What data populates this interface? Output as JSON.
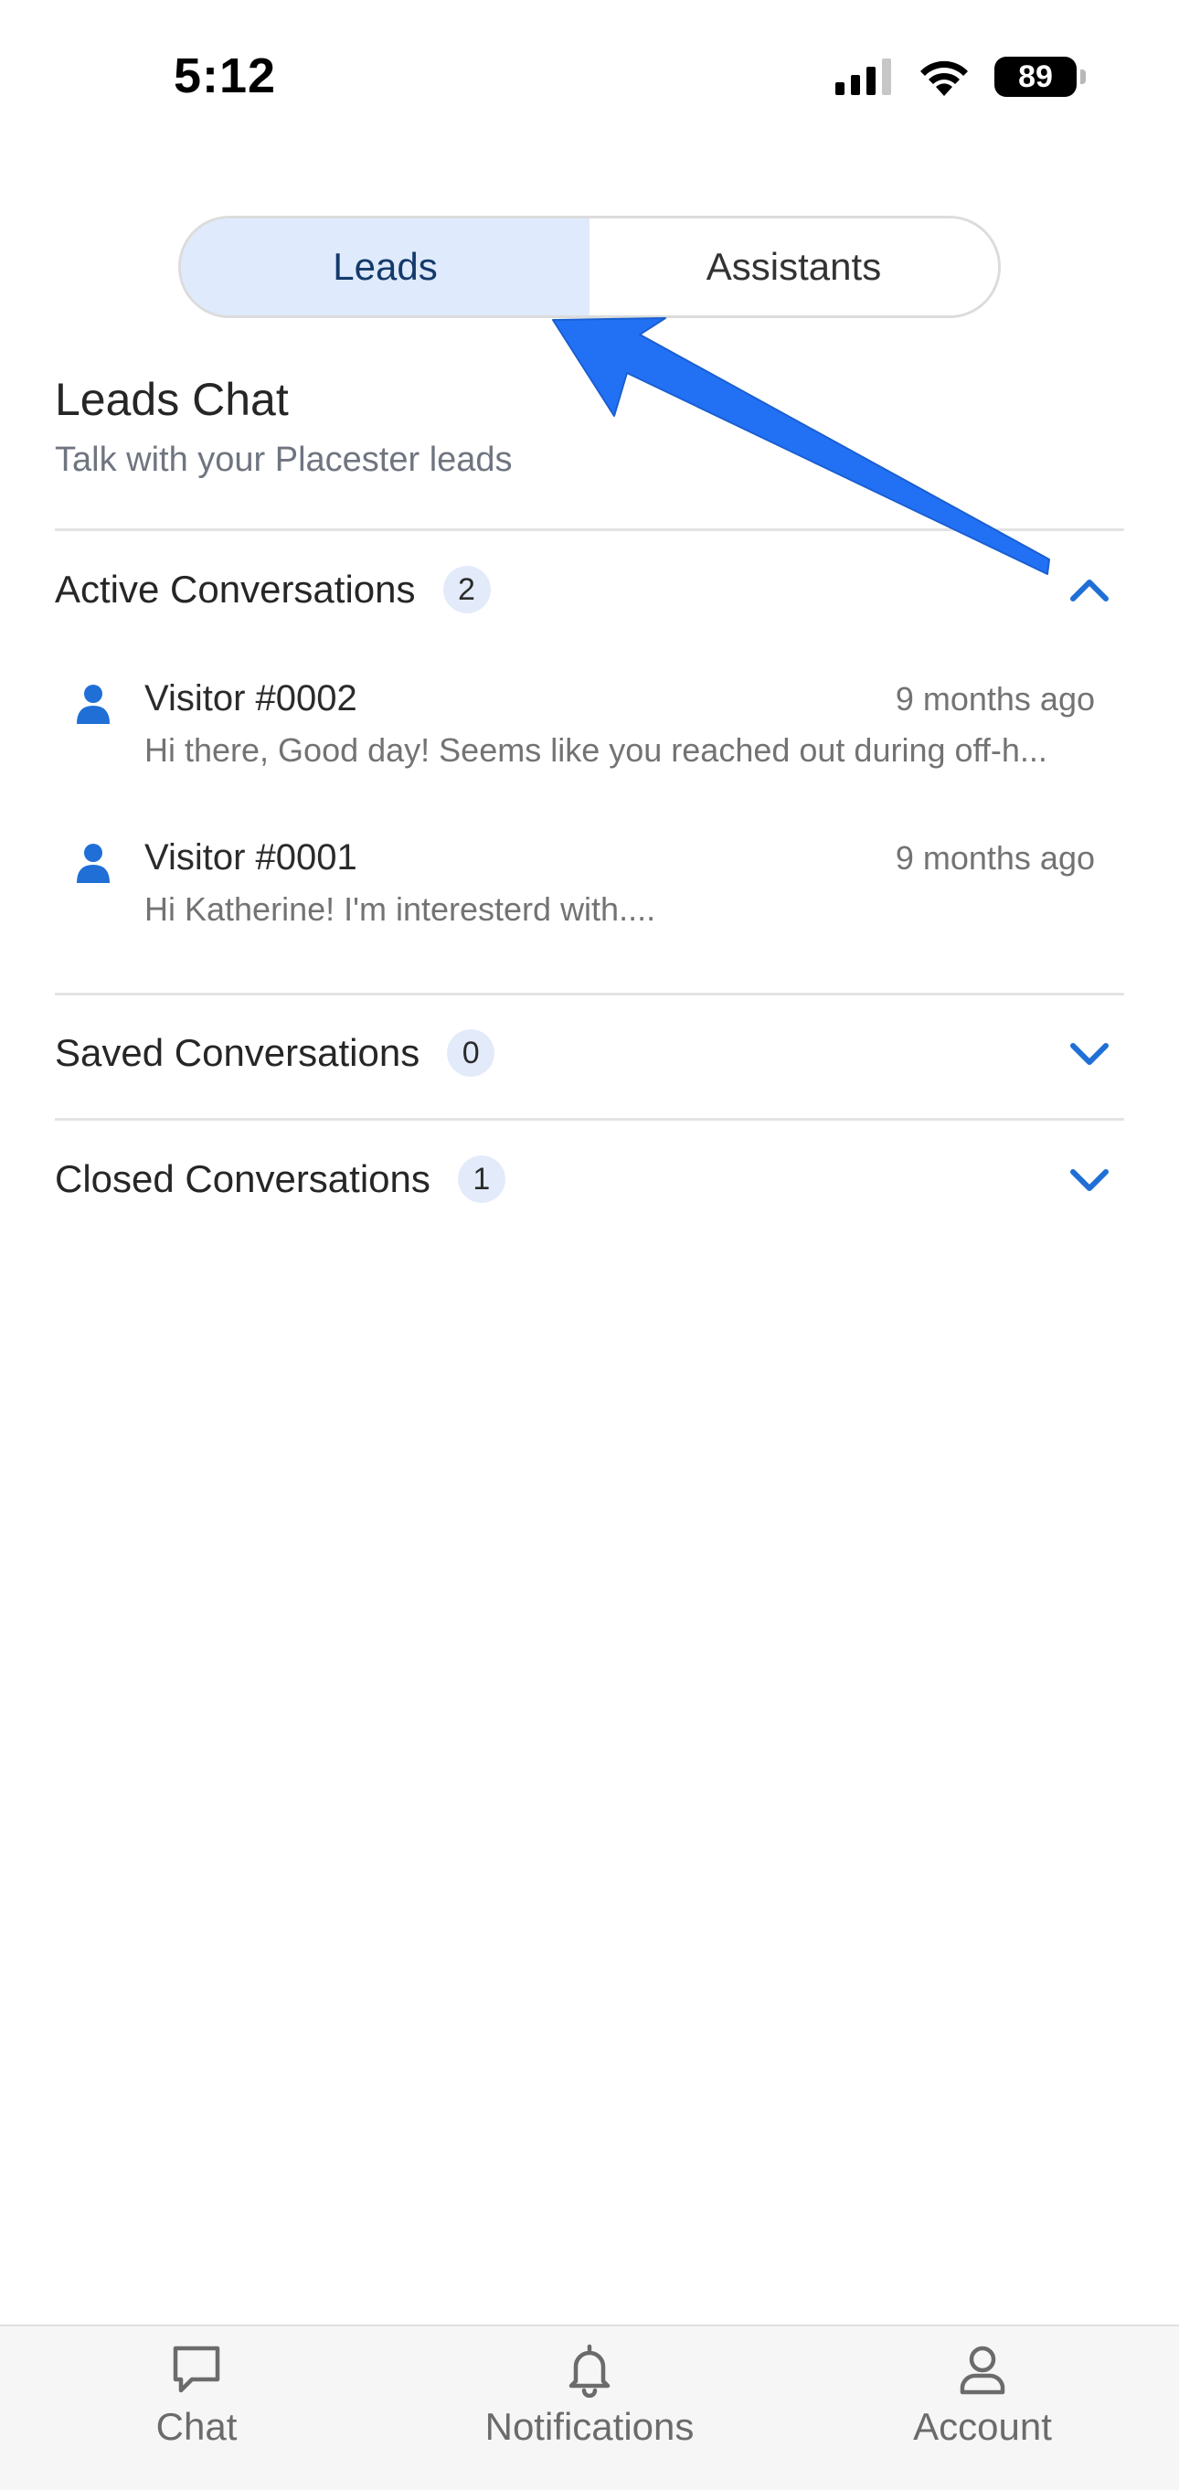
{
  "status_bar": {
    "time": "5:12",
    "battery": "89",
    "icons": [
      "cellular-signal-icon",
      "wifi-icon",
      "battery-icon"
    ]
  },
  "tabs": [
    {
      "label": "Leads",
      "active": true
    },
    {
      "label": "Assistants",
      "active": false
    }
  ],
  "header": {
    "title": "Leads Chat",
    "subtitle": "Talk with your Placester leads"
  },
  "sections": {
    "active": {
      "title": "Active Conversations",
      "count": "2",
      "expanded": true,
      "items": [
        {
          "name": "Visitor #0002",
          "time": "9 months ago",
          "preview": "Hi there, Good day! Seems like you reached out during off-h..."
        },
        {
          "name": "Visitor #0001",
          "time": "9 months ago",
          "preview": "Hi Katherine! I'm interesterd with...."
        }
      ]
    },
    "saved": {
      "title": "Saved Conversations",
      "count": "0",
      "expanded": false
    },
    "closed": {
      "title": "Closed Conversations",
      "count": "1",
      "expanded": false
    }
  },
  "bottom_nav": [
    {
      "label": "Chat",
      "icon": "chat-bubble-icon"
    },
    {
      "label": "Notifications",
      "icon": "bell-icon"
    },
    {
      "label": "Account",
      "icon": "person-icon"
    }
  ],
  "colors": {
    "accent": "#1f6fd6",
    "annotation_arrow": "#2271f5",
    "active_tab_bg": "#dfeafc",
    "active_tab_text": "#143a6b",
    "badge_bg": "#e3ebfa"
  }
}
